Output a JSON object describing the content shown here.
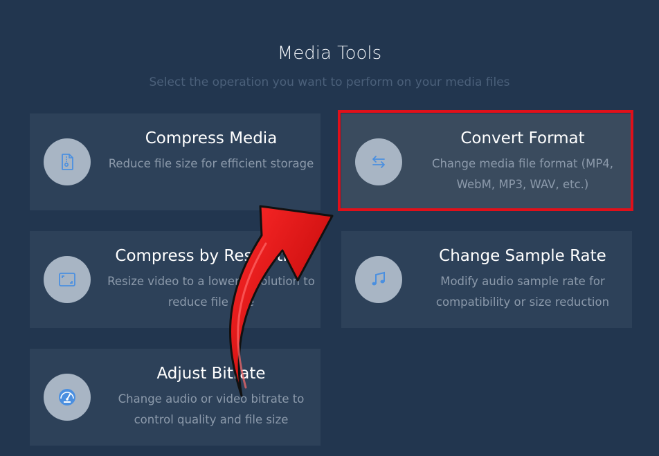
{
  "header": {
    "title": "Media Tools",
    "subtitle": "Select the operation you want to perform on your media files"
  },
  "tools": [
    {
      "title": "Compress Media",
      "description": "Reduce file size for efficient storage",
      "icon": "file-zip-icon"
    },
    {
      "title": "Convert Format",
      "description": "Change media file format (MP4, WebM, MP3, WAV, etc.)",
      "icon": "swap-arrows-icon"
    },
    {
      "title": "Compress by Resolution",
      "description": "Resize video to a lower resolution to reduce file size",
      "icon": "expand-frame-icon"
    },
    {
      "title": "Change Sample Rate",
      "description": "Modify audio sample rate for compatibility or size reduction",
      "icon": "music-note-icon"
    },
    {
      "title": "Adjust Bitrate",
      "description": "Change audio or video bitrate to control quality and file size",
      "icon": "gauge-icon"
    }
  ],
  "colors": {
    "background": "#22364f",
    "card": "#2d4159",
    "card_highlighted": "#3a4b5e",
    "icon_circle": "#a8b5c4",
    "icon_accent": "#4a8fe0",
    "annotation": "#e0101a"
  }
}
